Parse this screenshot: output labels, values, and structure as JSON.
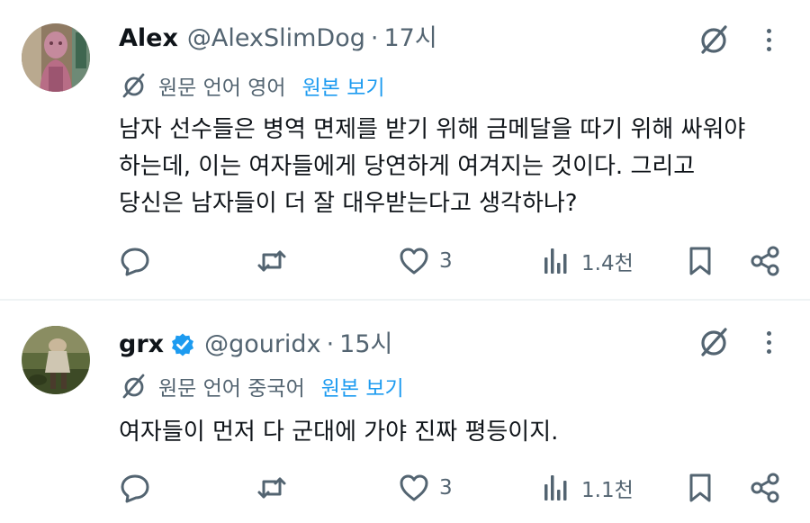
{
  "tweets": [
    {
      "display_name": "Alex",
      "verified": false,
      "handle": "@AlexSlimDog",
      "separator": "·",
      "time": "17시",
      "translation_label": "원문 언어 영어",
      "show_original": "원본 보기",
      "text": "남자 선수들은 병역 면제를 받기 위해 금메달을 따기 위해 싸워야\n하는데, 이는 여자들에게 당연하게 여겨지는 것이다. 그리고\n당신은 남자들이 더 잘 대우받는다고 생각하나?",
      "like_count": "3",
      "view_count": "1.4천"
    },
    {
      "display_name": "grx",
      "verified": true,
      "handle": "@gouridx",
      "separator": "·",
      "time": "15시",
      "translation_label": "원문 언어 중국어",
      "show_original": "원본 보기",
      "text": "여자들이 먼저 다 군대에 가야 진짜 평등이지.",
      "like_count": "3",
      "view_count": "1.1천"
    }
  ],
  "icons": {
    "reply": "reply-icon",
    "retweet": "retweet-icon",
    "like": "heart-icon",
    "views": "views-icon",
    "bookmark": "bookmark-icon",
    "share": "share-icon",
    "grok": "grok-icon",
    "more": "more-icon",
    "translate": "translate-icon"
  },
  "colors": {
    "text": "#0f1419",
    "secondary": "#536471",
    "link": "#1d9bf0",
    "divider": "#eff3f4"
  }
}
